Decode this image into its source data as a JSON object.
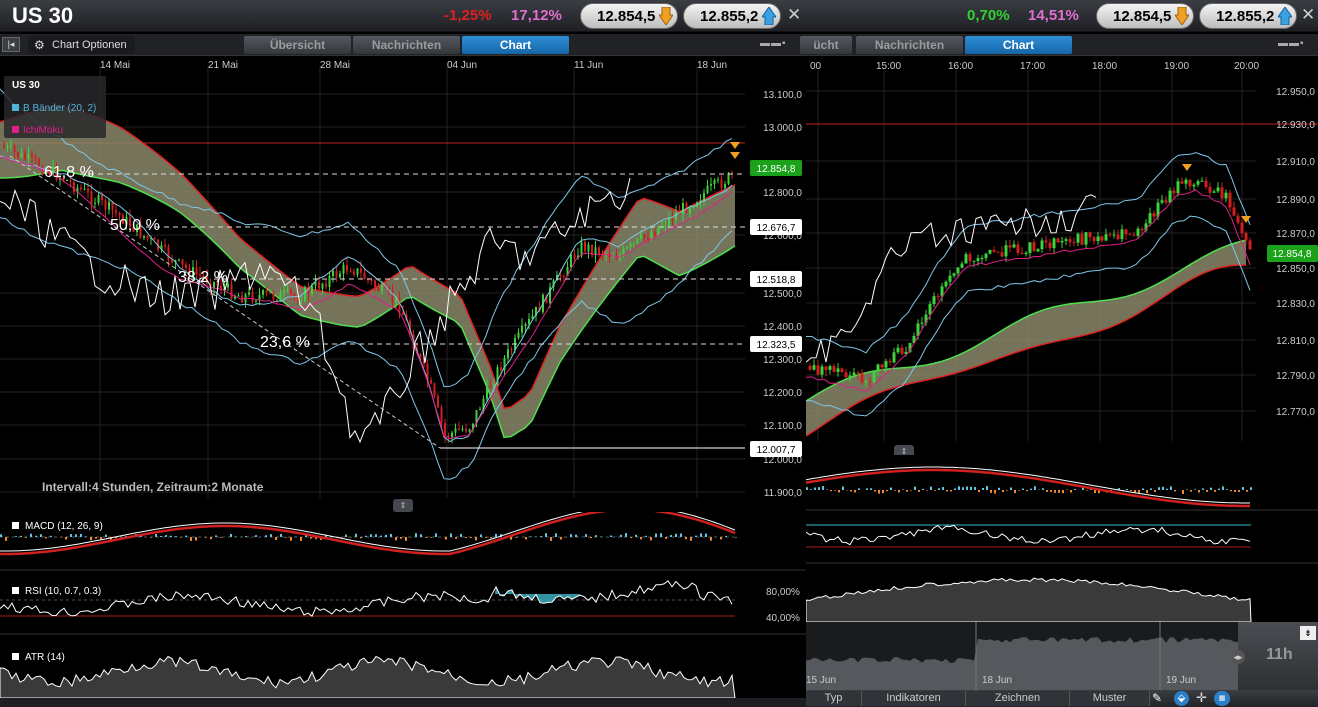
{
  "left_window": {
    "symbol": "US 30",
    "change_abs": "-1,25%",
    "change_pct": "17,12%",
    "bid": "12.854,5",
    "ask": "12.855,2",
    "close_glyph": "✕",
    "options_label": "Chart Optionen",
    "tabs": [
      "Übersicht",
      "Nachrichten",
      "Chart"
    ],
    "active_tab": "Chart",
    "window_controls": "▬▬▪",
    "legend": {
      "title": "US 30",
      "items": [
        {
          "label": "B Bänder (20, 2)",
          "color": "#4fb3d9"
        },
        {
          "label": "IchiMoku",
          "color": "#e0208a"
        }
      ]
    },
    "x_dates": [
      "14 Mai",
      "21 Mai",
      "28 Mai",
      "04 Jun",
      "11 Jun",
      "18 Jun"
    ],
    "y_ticks": [
      "13.100,0",
      "13.000,0",
      "12.800,0",
      "12.600,0",
      "12.500,0",
      "12.400,0",
      "12.300,0",
      "12.200,0",
      "12.100,0",
      "12.000,0",
      "11.900,0"
    ],
    "price_tags": [
      {
        "label": "12.854,8",
        "style": "green"
      },
      {
        "label": "12.676,7",
        "style": "white"
      },
      {
        "label": "12.518,8",
        "style": "white"
      },
      {
        "label": "12.323,5",
        "style": "white"
      },
      {
        "label": "12.007,7",
        "style": "white"
      }
    ],
    "fib_levels": [
      "61,8 %",
      "50,0 %",
      "38,2 %",
      "23,6 %"
    ],
    "interval_text": "Intervall:4 Stunden, Zeitraum:2 Monate",
    "indicators": [
      {
        "label": "MACD (12, 26, 9)"
      },
      {
        "label": "RSI (10, 0.7, 0.3)",
        "levels": [
          "80,00%",
          "40,00%"
        ]
      },
      {
        "label": "ATR (14)"
      }
    ]
  },
  "right_window": {
    "change_abs": "0,70%",
    "change_pct": "14,51%",
    "bid": "12.854,5",
    "ask": "12.855,2",
    "close_glyph": "✕",
    "tabs": [
      "ücht",
      "Nachrichten",
      "Chart"
    ],
    "active_tab": "Chart",
    "window_controls": "▬▬▪",
    "x_times": [
      "00",
      "15:00",
      "16:00",
      "17:00",
      "18:00",
      "19:00",
      "20:00"
    ],
    "y_ticks": [
      "12.950,0",
      "12.930,0",
      "12.910,0",
      "12.890,0",
      "12.870,0",
      "12.850,0",
      "12.830,0",
      "12.810,0",
      "12.790,0",
      "12.770,0"
    ],
    "price_tag": "12.854,8",
    "overview_dates": [
      "15 Jun",
      "18 Jun",
      "19 Jun"
    ],
    "zoom_label": "11h",
    "bottom_tabs": [
      "Typ",
      "Indikatoren",
      "Zeichnen",
      "Muster"
    ]
  },
  "colors": {
    "up": "#3cd23c",
    "down": "#d21e1e",
    "bollinger": "#7ec8e8",
    "ichimoku": "#e0208a",
    "cloud": "#8a8768",
    "price_green": "#1aa31a",
    "positive_text": "#2fd22f",
    "negative_text": "#e02020",
    "pct_text": "#e070d0"
  }
}
